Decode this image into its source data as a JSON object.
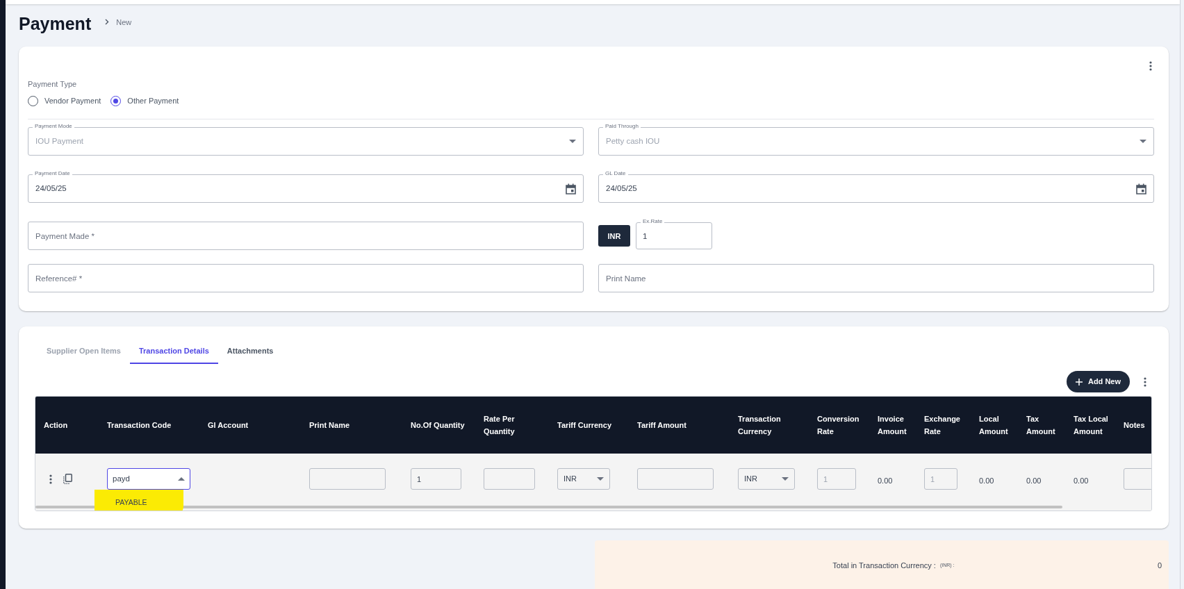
{
  "page": {
    "title": "Payment",
    "breadcrumb": "New"
  },
  "payment_type": {
    "label": "Payment Type",
    "options": [
      {
        "label": "Vendor Payment",
        "selected": false
      },
      {
        "label": "Other Payment",
        "selected": true
      }
    ]
  },
  "form_rows": [
    [
      {
        "kind": "select",
        "label": "Payment Mode",
        "value": "IOU Payment",
        "disabled": true
      },
      {
        "kind": "select",
        "label": "Paid Through",
        "value": "Petty cash IOU",
        "disabled": true
      }
    ],
    [
      {
        "kind": "date",
        "label": "Payment Date",
        "value": "24/05/25",
        "disabled": false
      },
      {
        "kind": "date",
        "label": "GL Date",
        "value": "24/05/25",
        "disabled": false
      }
    ],
    [
      {
        "kind": "text",
        "placeholder": "Payment Made *"
      },
      {
        "kind": "currency",
        "currency": "INR",
        "label": "Ex.Rate",
        "value": "1"
      }
    ],
    [
      {
        "kind": "text",
        "placeholder": "Reference# *"
      },
      {
        "kind": "text",
        "placeholder": "Print Name"
      }
    ]
  ],
  "tabs": [
    {
      "label": "Supplier Open Items",
      "selected": false,
      "disabled": true
    },
    {
      "label": "Transaction Details",
      "selected": true,
      "disabled": false
    },
    {
      "label": "Attachments",
      "selected": false,
      "disabled": false
    }
  ],
  "add_button": "Add New",
  "table": {
    "columns": [
      "Action",
      "Transaction Code",
      "Gl Account",
      "Print Name",
      "No.Of Quantity",
      "Rate Per Quantity",
      "Tariff Currency",
      "Tariff Amount",
      "Transaction Currency",
      "Conversion Rate",
      "Invoice Amount",
      "Exchange Rate",
      "Local Amount",
      "Tax Amount",
      "Tax Local Amount",
      "Notes"
    ],
    "rows": [
      {
        "cells": [
          {
            "kind": "actions"
          },
          {
            "kind": "combo",
            "value": "payd",
            "expanded": true,
            "options": [
              {
                "label": "PAYABLE",
                "highlighted": true
              }
            ]
          },
          {
            "kind": "empty"
          },
          {
            "kind": "input"
          },
          {
            "kind": "input",
            "value": "1",
            "disabled": false
          },
          {
            "kind": "input"
          },
          {
            "kind": "select",
            "value": "INR"
          },
          {
            "kind": "input"
          },
          {
            "kind": "select",
            "value": "INR"
          },
          {
            "kind": "input",
            "value": "1",
            "disabled": true
          },
          {
            "kind": "text",
            "value": "0.00"
          },
          {
            "kind": "input",
            "value": "1",
            "disabled": true
          },
          {
            "kind": "text",
            "value": "0.00"
          },
          {
            "kind": "text",
            "value": "0.00"
          },
          {
            "kind": "text",
            "value": "0.00"
          },
          {
            "kind": "input"
          }
        ]
      }
    ]
  },
  "total": {
    "label": "Total in Transaction Currency :",
    "currency": "(INR) :",
    "value": "0"
  }
}
